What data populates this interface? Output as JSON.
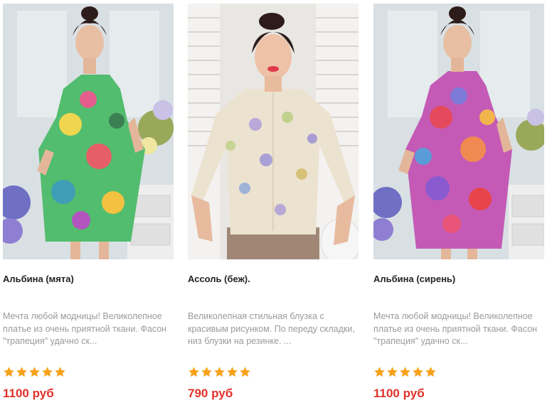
{
  "theme": {
    "title_color": "#222222",
    "desc_color": "#9a9a9a",
    "price_color": "#e0322a",
    "star_color": "#f7a21b"
  },
  "products": [
    {
      "title": "Альбина (мята)",
      "description": "Мечта любой модницы! Великолепное платье из очень приятной ткани. Фасон \"трапеция\" удачно ск...",
      "rating": 5,
      "rating_max": 5,
      "price": "1100 руб",
      "palette": "mint"
    },
    {
      "title": "Ассоль (беж).",
      "description": "Великолепная стильная блузка с красивым рисунком. По переду складки, низ блузки на резинке. ...",
      "rating": 5,
      "rating_max": 5,
      "price": "790 руб",
      "palette": "beige"
    },
    {
      "title": "Альбина (сирень)",
      "description": "Мечта любой модницы! Великолепное платье из очень приятной ткани. Фасон \"трапеция\" удачно ск...",
      "rating": 5,
      "rating_max": 5,
      "price": "1100 руб",
      "palette": "lilac"
    }
  ]
}
